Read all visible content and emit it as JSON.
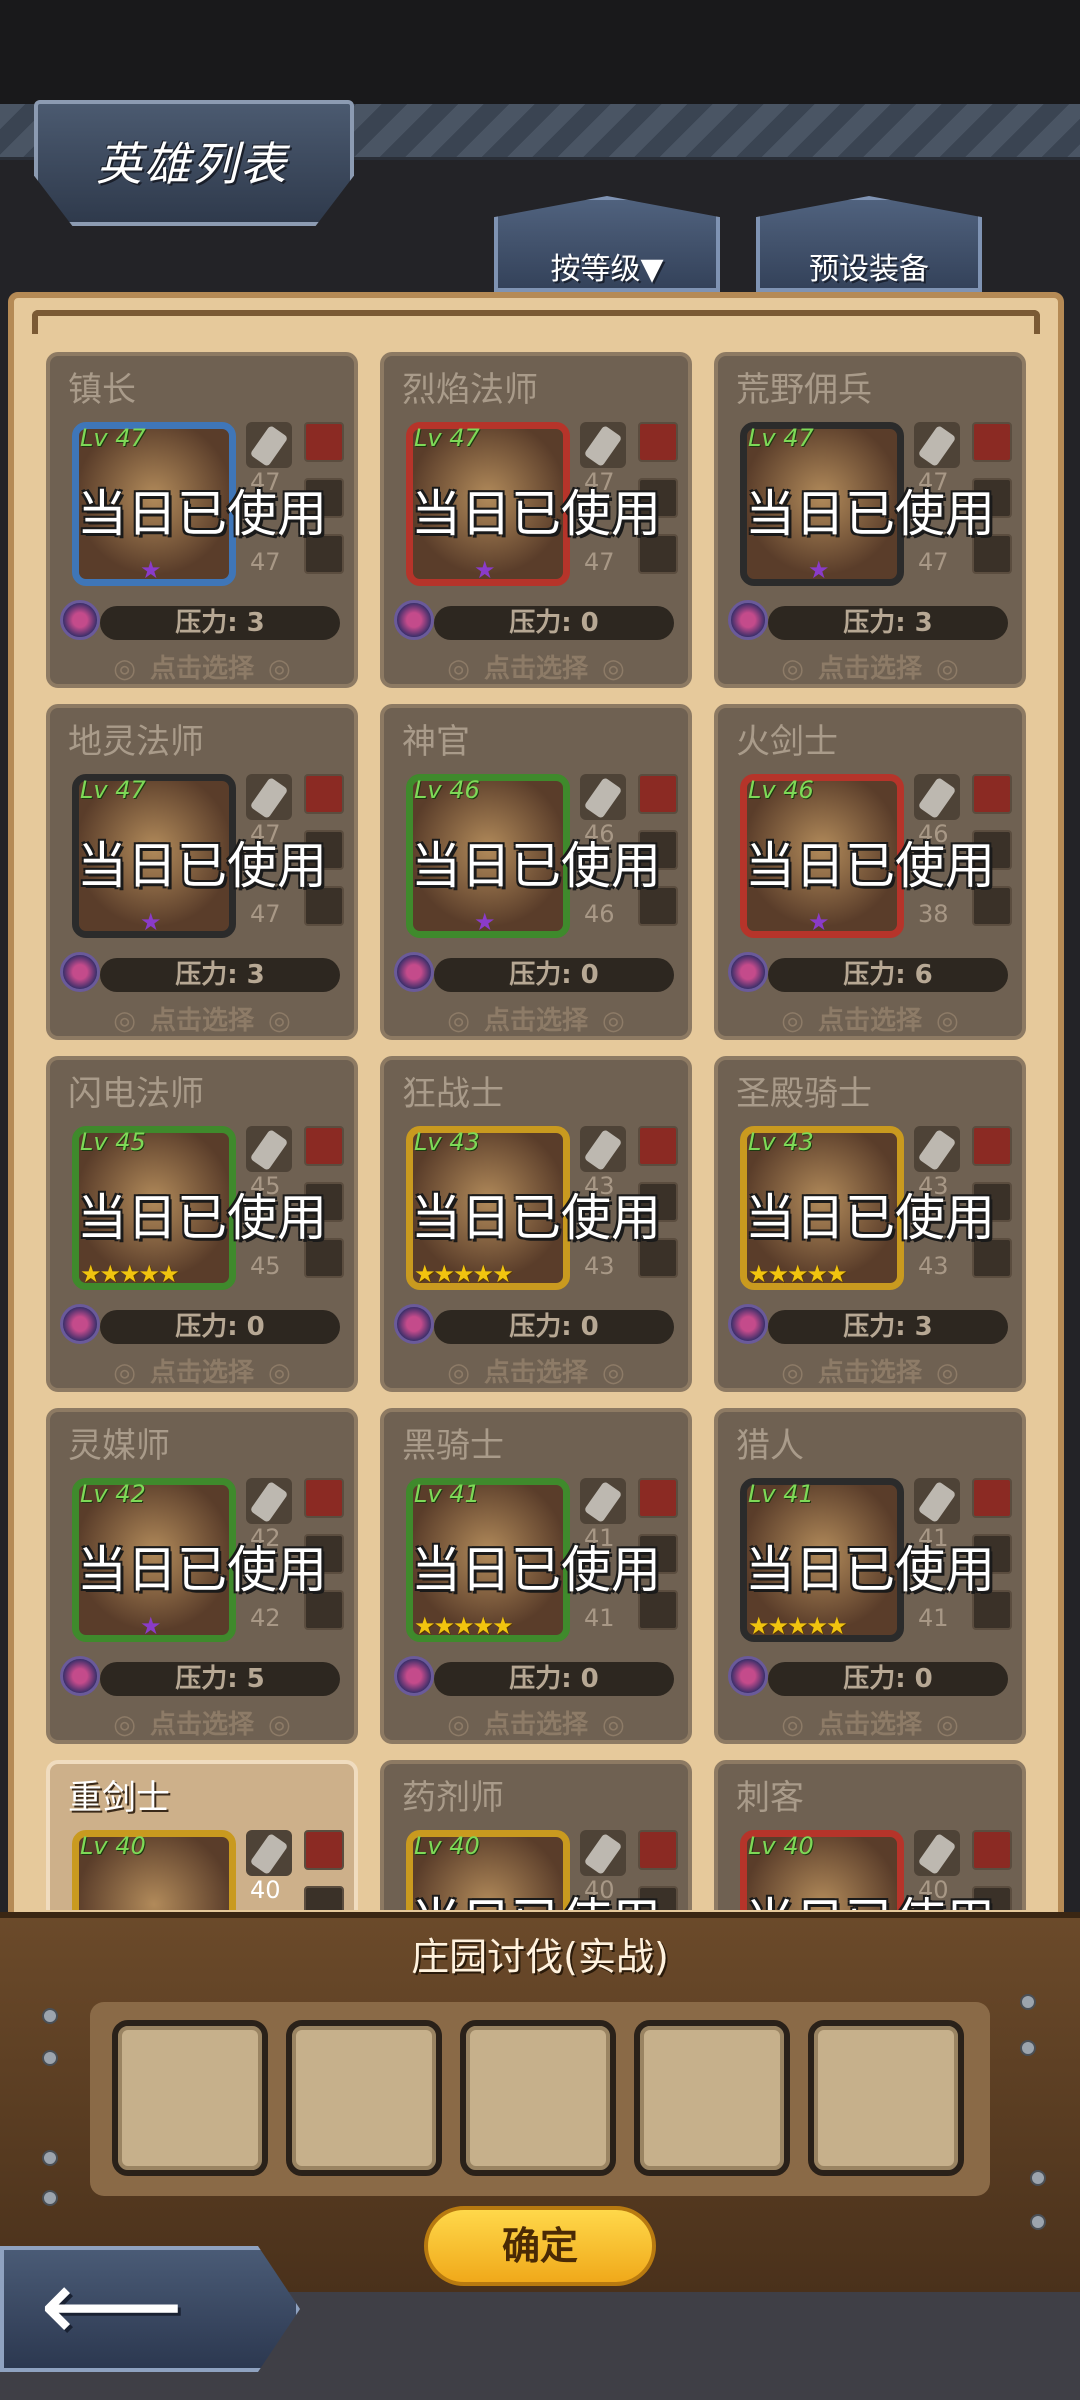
{
  "header": {
    "title": "英雄列表",
    "sort_tab": "按等级▼",
    "preset_tab": "预设装备"
  },
  "overlay_text": "当日已使用",
  "select_text": "点击选择",
  "heroes": [
    {
      "name": "镇长",
      "level": "Lv 47",
      "top_num": "47",
      "bottom_num": "47",
      "pressure": "压力: 3",
      "used": true
    },
    {
      "name": "烈焰法师",
      "level": "Lv 47",
      "top_num": "47",
      "bottom_num": "47",
      "pressure": "压力: 0",
      "used": true
    },
    {
      "name": "荒野佣兵",
      "level": "Lv 47",
      "top_num": "47",
      "bottom_num": "47",
      "pressure": "压力: 3",
      "used": true
    },
    {
      "name": "地灵法师",
      "level": "Lv 47",
      "top_num": "47",
      "bottom_num": "47",
      "pressure": "压力: 3",
      "used": true
    },
    {
      "name": "神官",
      "level": "Lv 46",
      "top_num": "46",
      "bottom_num": "46",
      "pressure": "压力: 0",
      "used": true
    },
    {
      "name": "火剑士",
      "level": "Lv 46",
      "top_num": "46",
      "bottom_num": "38",
      "pressure": "压力: 6",
      "used": true
    },
    {
      "name": "闪电法师",
      "level": "Lv 45",
      "top_num": "45",
      "bottom_num": "45",
      "pressure": "压力: 0",
      "used": true
    },
    {
      "name": "狂战士",
      "level": "Lv 43",
      "top_num": "43",
      "bottom_num": "43",
      "pressure": "压力: 0",
      "used": true
    },
    {
      "name": "圣殿骑士",
      "level": "Lv 43",
      "top_num": "43",
      "bottom_num": "43",
      "pressure": "压力: 3",
      "used": true
    },
    {
      "name": "灵媒师",
      "level": "Lv 42",
      "top_num": "42",
      "bottom_num": "42",
      "pressure": "压力: 5",
      "used": true
    },
    {
      "name": "黑骑士",
      "level": "Lv 41",
      "top_num": "41",
      "bottom_num": "41",
      "pressure": "压力: 0",
      "used": true
    },
    {
      "name": "猎人",
      "level": "Lv 41",
      "top_num": "41",
      "bottom_num": "41",
      "pressure": "压力: 0",
      "used": true
    },
    {
      "name": "重剑士",
      "level": "Lv 40",
      "top_num": "40",
      "bottom_num": "",
      "pressure": "",
      "used": false
    },
    {
      "name": "药剂师",
      "level": "Lv 40",
      "top_num": "40",
      "bottom_num": "",
      "pressure": "",
      "used": true
    },
    {
      "name": "刺客",
      "level": "Lv 40",
      "top_num": "40",
      "bottom_num": "",
      "pressure": "",
      "used": true
    }
  ],
  "team_panel": {
    "title": "庄园讨伐(实战)",
    "confirm": "确定"
  },
  "icons": {
    "back": "back-arrow-icon",
    "pressure": "pressure-icon",
    "weapon": "sword-icon"
  },
  "colors": {
    "panel_bg": "#e6c99b",
    "card_bg": "#6f6152",
    "confirm_btn": "#f5c12a",
    "level_text": "#7ed957"
  }
}
